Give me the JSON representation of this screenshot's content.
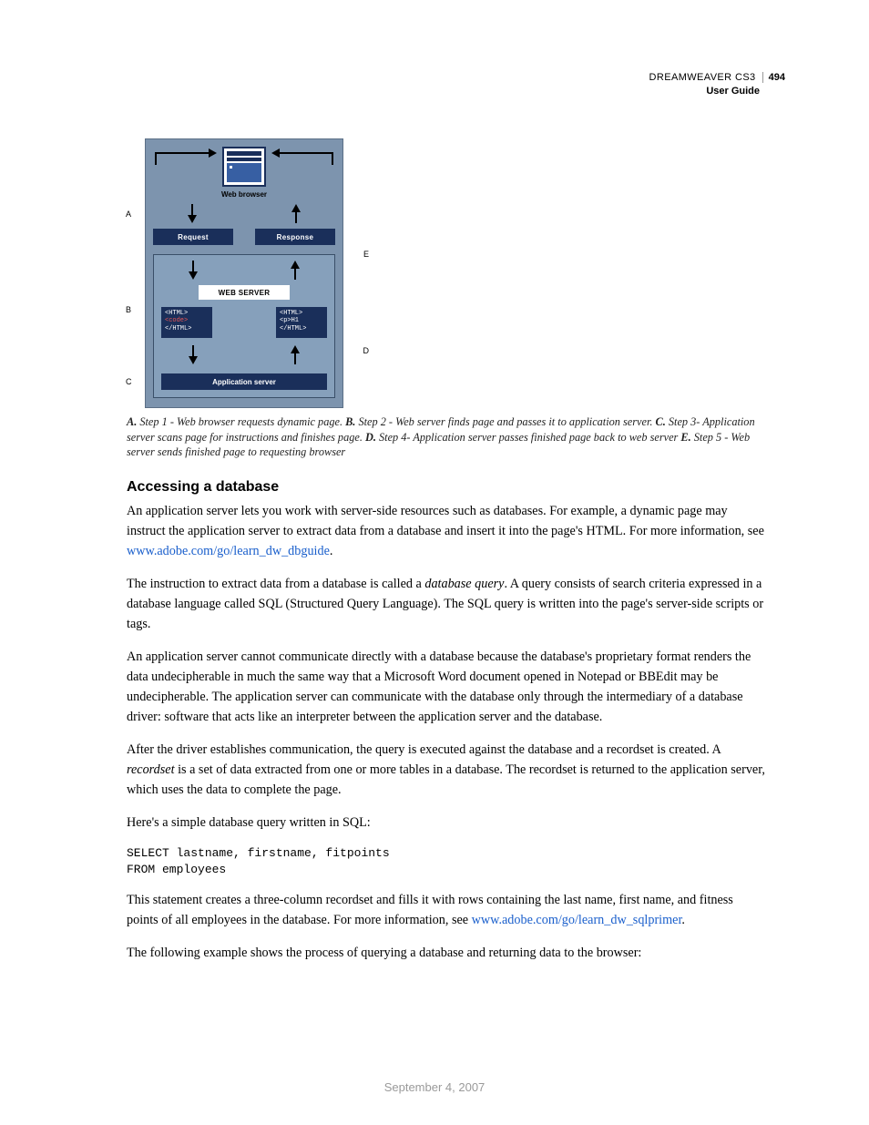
{
  "header": {
    "product": "DREAMWEAVER CS3",
    "page_number": "494",
    "subtitle": "User Guide"
  },
  "diagram": {
    "web_browser": "Web browser",
    "request": "Request",
    "response": "Response",
    "web_server": "WEB SERVER",
    "html_open": "<HTML>",
    "code_red": "<code>",
    "html_close": "</HTML>",
    "p_h1": "<p>H1",
    "app_server": "Application server",
    "labels": {
      "a": "A",
      "b": "B",
      "c": "C",
      "d": "D",
      "e": "E"
    }
  },
  "caption": {
    "a_bold": "A.",
    "a_text": " Step 1 - Web browser requests dynamic page.  ",
    "b_bold": "B.",
    "b_text": " Step 2 - Web server finds page and passes it to application server.  ",
    "c_bold": "C.",
    "c_text": " Step 3- Application server scans page for instructions and finishes page.  ",
    "d_bold": "D.",
    "d_text": " Step 4- Application server passes finished page back to web server  ",
    "e_bold": "E.",
    "e_text": " Step 5 - Web server sends finished page to requesting browser"
  },
  "section_title": "Accessing a database",
  "body": {
    "p1a": "An application server lets you work with server-side resources such as databases. For example, a dynamic page may instruct the application server to extract data from a database and insert it into the page's HTML. For more information, see ",
    "p1link": "www.adobe.com/go/learn_dw_dbguide",
    "p1b": ".",
    "p2a": "The instruction to extract data from a database is called a ",
    "p2em": "database query",
    "p2b": ". A query consists of search criteria expressed in a database language called SQL (Structured Query Language). The SQL query is written into the page's server-side scripts or tags.",
    "p3": "An application server cannot communicate directly with a database because the database's proprietary format renders the data undecipherable in much the same way that a Microsoft Word document opened in Notepad or BBEdit may be undecipherable. The application server can communicate with the database only through the intermediary of a database driver: software that acts like an interpreter between the application server and the database.",
    "p4a": "After the driver establishes communication, the query is executed against the database and a recordset is created. A ",
    "p4em": "recordset",
    "p4b": " is a set of data extracted from one or more tables in a database. The recordset is returned to the application server, which uses the data to complete the page.",
    "p5": "Here's a simple database query written in SQL:",
    "code": "SELECT lastname, firstname, fitpoints\nFROM employees",
    "p6a": "This statement creates a three-column recordset and fills it with rows containing the last name, first name, and fitness points of all employees in the database. For more information, see ",
    "p6link": "www.adobe.com/go/learn_dw_sqlprimer",
    "p6b": ".",
    "p7": "The following example shows the process of querying a database and returning data to the browser:"
  },
  "footer_date": "September 4, 2007"
}
